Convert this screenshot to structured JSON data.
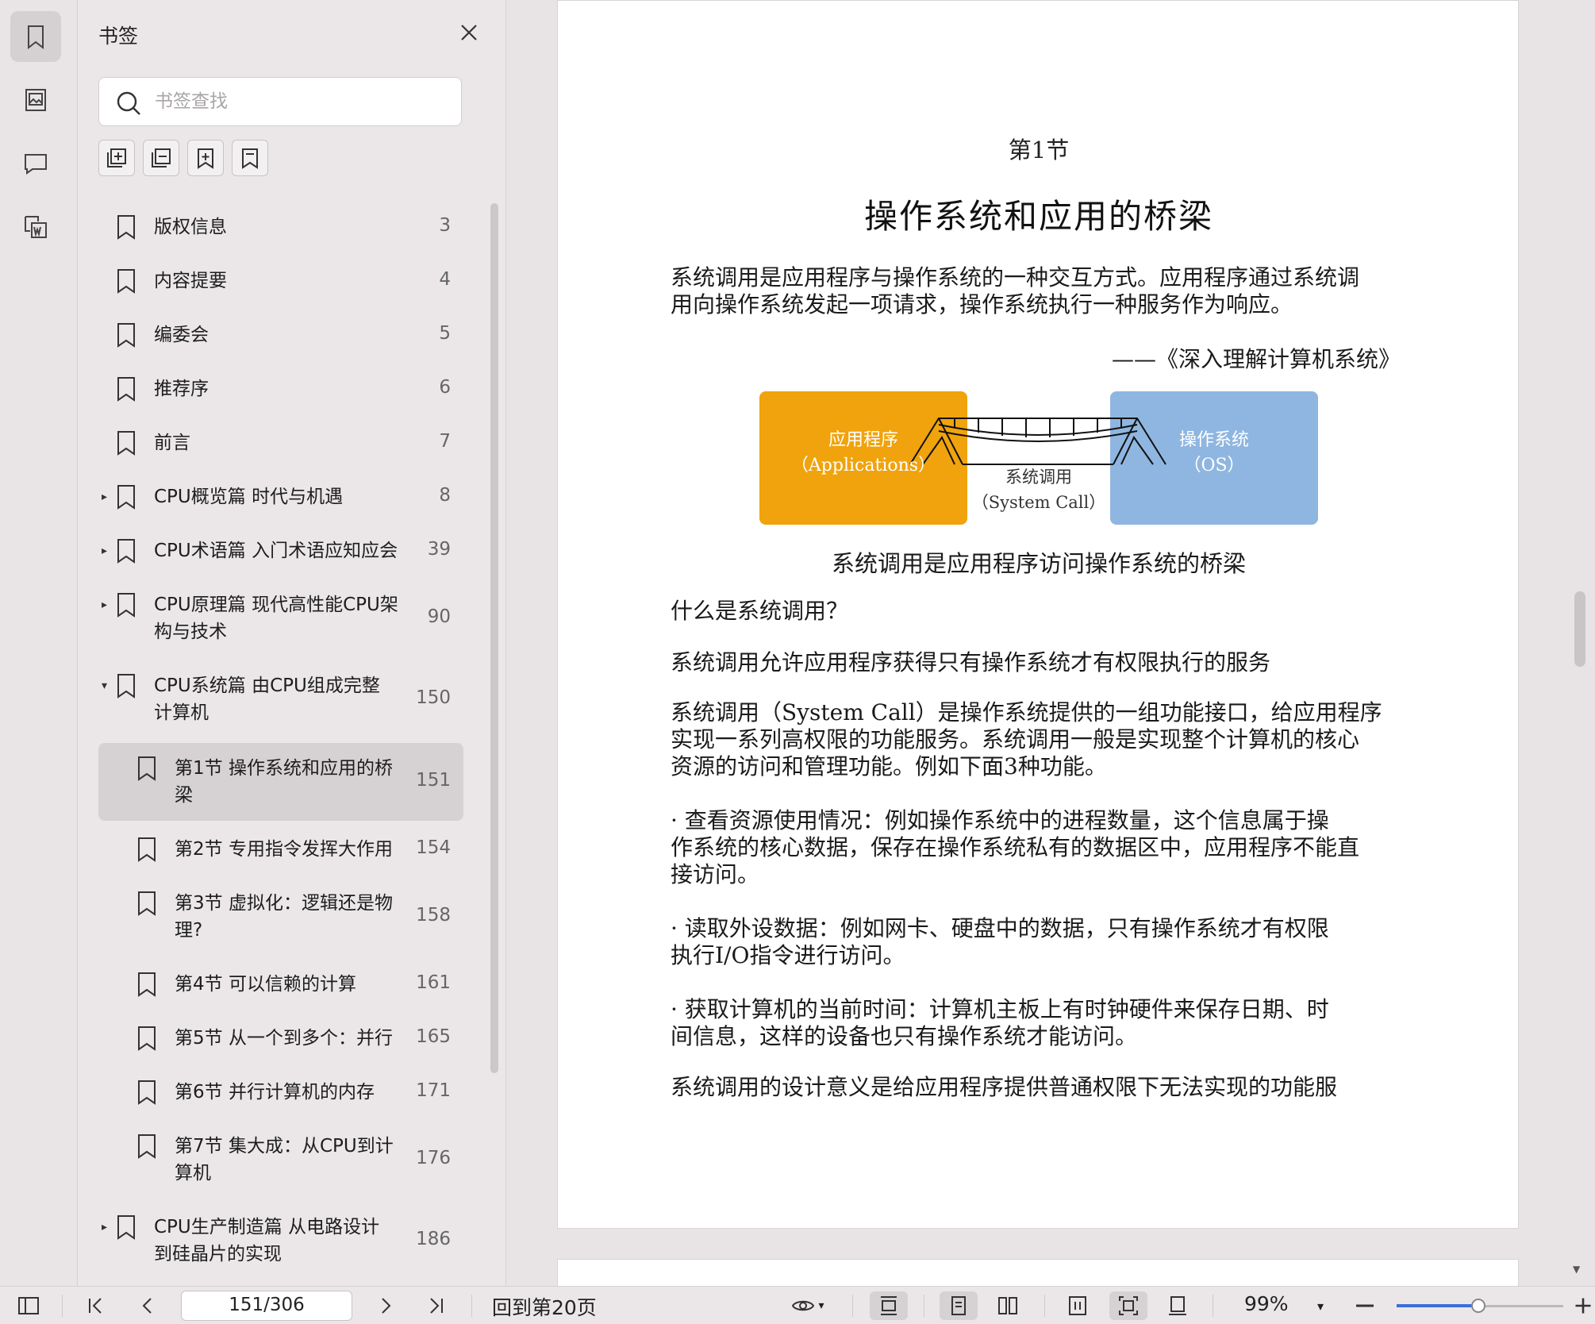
{
  "sidebar": {
    "title": "书签",
    "search_placeholder": "书签查找",
    "bookmarks": [
      {
        "label": "版权信息",
        "page": "3"
      },
      {
        "label": "内容提要",
        "page": "4"
      },
      {
        "label": "编委会",
        "page": "5"
      },
      {
        "label": "推荐序",
        "page": "6"
      },
      {
        "label": "前言",
        "page": "7"
      },
      {
        "label": "CPU概览篇 时代与机遇",
        "page": "8"
      },
      {
        "label": "CPU术语篇 入门术语应知应会",
        "page": "39"
      },
      {
        "label_line1": "CPU原理篇 现代高性能CPU架",
        "label_line2": "构与技术",
        "page": "90"
      },
      {
        "label_line1": "CPU系统篇 由CPU组成完整",
        "label_line2": "计算机",
        "page": "150"
      },
      {
        "label_line1": "第1节 操作系统和应用的桥",
        "label_line2": "梁",
        "page": "151"
      },
      {
        "label": "第2节 专用指令发挥大作用",
        "page": "154"
      },
      {
        "label_line1": "第3节 虚拟化：逻辑还是物",
        "label_line2": "理?",
        "page": "158"
      },
      {
        "label": "第4节 可以信赖的计算",
        "page": "161"
      },
      {
        "label": "第5节 从一个到多个：并行",
        "page": "165"
      },
      {
        "label": "第6节 并行计算机的内存",
        "page": "171"
      },
      {
        "label_line1": "第7节 集大成：从CPU到计",
        "label_line2": "算机",
        "page": "176"
      },
      {
        "label_line1": "CPU生产制造篇 从电路设计",
        "label_line2": "到硅晶片的实现",
        "page": "186"
      }
    ]
  },
  "document": {
    "section_number": "第1节",
    "section_title": "操作系统和应用的桥梁",
    "quote_line1": "系统调用是应用程序与操作系统的一种交互方式。应用程序通过系统调",
    "quote_line2": "用向操作系统发起一项请求，操作系统执行一种服务作为响应。",
    "quote_source": "——《深入理解计算机系统》",
    "diagram": {
      "left_line1": "应用程序",
      "left_line2": "（Applications）",
      "middle_line1": "系统调用",
      "middle_line2": "（System Call）",
      "right_line1": "操作系统",
      "right_line2": "（OS）"
    },
    "figure_caption": "系统调用是应用程序访问操作系统的桥梁",
    "question": "什么是系统调用？",
    "p1": "系统调用允许应用程序获得只有操作系统才有权限执行的服务",
    "p2_line1": "系统调用（System Call）是操作系统提供的一组功能接口，给应用程序",
    "p2_line2": "实现一系列高权限的功能服务。系统调用一般是实现整个计算机的核心",
    "p2_line3": "资源的访问和管理功能。例如下面3种功能。",
    "b1_line1": "· 查看资源使用情况：例如操作系统中的进程数量，这个信息属于操",
    "b1_line2": "作系统的核心数据，保存在操作系统私有的数据区中，应用程序不能直",
    "b1_line3": "接访问。",
    "b2_line1": "· 读取外设数据：例如网卡、硬盘中的数据，只有操作系统才有权限",
    "b2_line2": "执行I/O指令进行访问。",
    "b3_line1": "· 获取计算机的当前时间：计算机主板上有时钟硬件来保存日期、时",
    "b3_line2": "间信息，这样的设备也只有操作系统才能访问。",
    "p3": "系统调用的设计意义是给应用程序提供普通权限下无法实现的功能服"
  },
  "statusbar": {
    "page_indicator": "151/306",
    "goto_label": "回到第20页",
    "zoom": "99%",
    "zoom_slider_fraction": 0.49
  },
  "colors": {
    "app_box": "#f0a30c",
    "os_box": "#8fb6e0",
    "slider_accent": "#3a6fd8"
  }
}
